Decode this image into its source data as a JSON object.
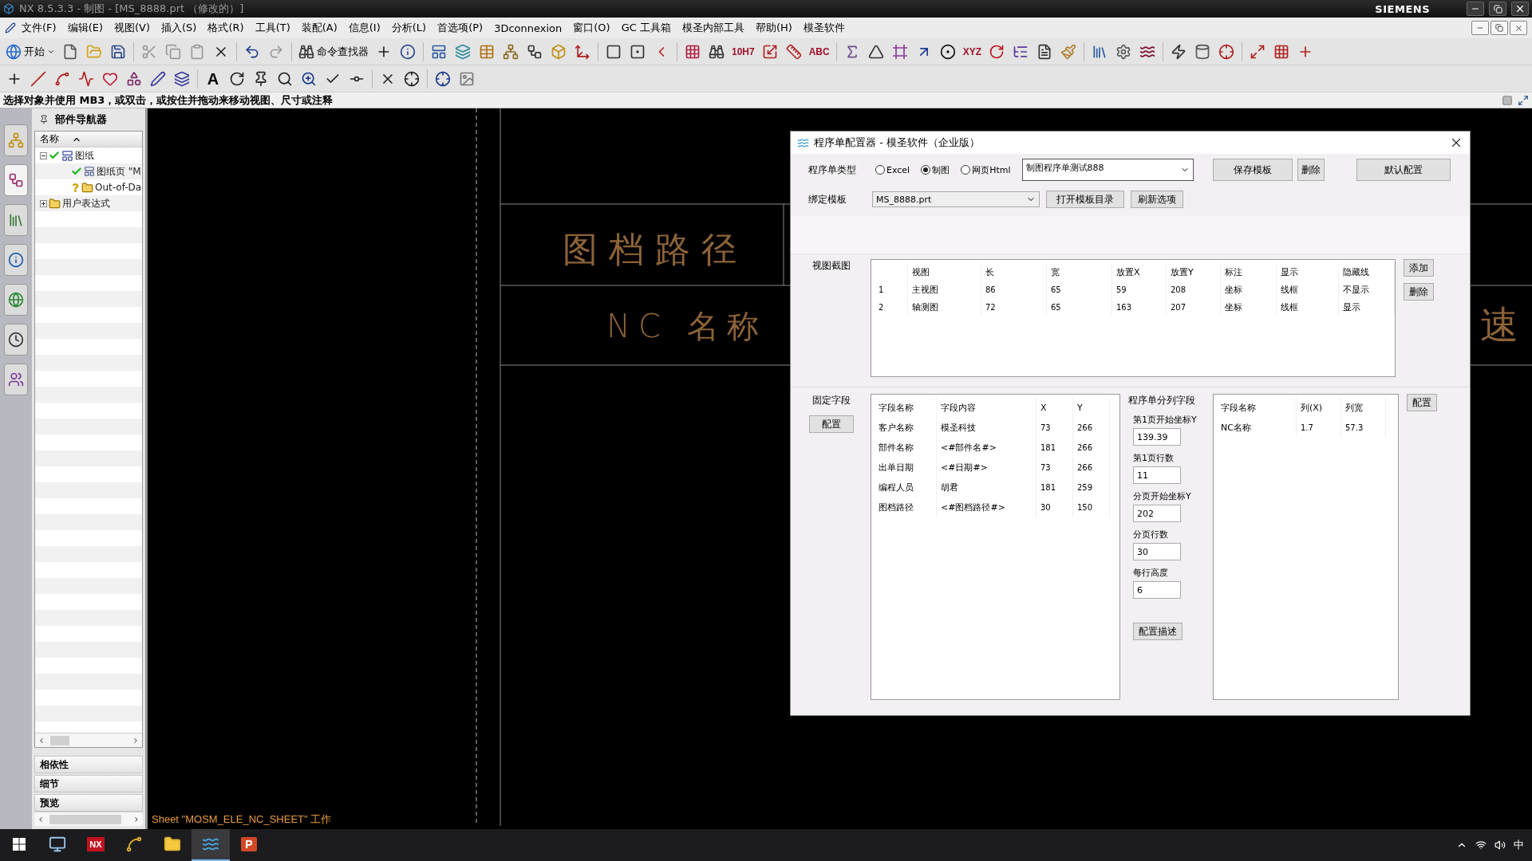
{
  "title_bar": {
    "title": "NX 8.5.3.3 - 制图 - [MS_8888.prt （修改的）]",
    "brand": "SIEMENS"
  },
  "menu": [
    "文件(F)",
    "编辑(E)",
    "视图(V)",
    "插入(S)",
    "格式(R)",
    "工具(T)",
    "装配(A)",
    "信息(I)",
    "分析(L)",
    "首选项(P)",
    "3Dconnexion",
    "窗口(O)",
    "GC 工具箱",
    "模圣内部工具",
    "帮助(H)",
    "模圣软件"
  ],
  "toolbar": {
    "start": "开始",
    "command_finder": "命令查找器",
    "row1_labels": [
      "10H7",
      "ABC",
      "XYZ"
    ],
    "row2_labels": [
      "A"
    ]
  },
  "prompt": "选择对象并使用 MB3，或双击，或按住并拖动来移动视图、尺寸或注释",
  "side_tabs": [
    {
      "selected": false
    },
    {
      "selected": true
    },
    {
      "selected": false
    },
    {
      "selected": false
    },
    {
      "selected": false
    },
    {
      "selected": false
    },
    {
      "selected": false
    }
  ],
  "navigator": {
    "title": "部件导航器",
    "column": "名称",
    "tree": [
      {
        "label": "图纸",
        "up_to_date": true,
        "expanded": true,
        "children": [
          {
            "label": "图纸页 \"M",
            "up_to_date": true,
            "kind": "sheet"
          },
          {
            "label": "Out-of-Da",
            "up_to_date": false,
            "kind": "folder"
          }
        ]
      },
      {
        "label": "用户表达式",
        "expanded": false
      }
    ],
    "panels": [
      "相依性",
      "细节",
      "预览"
    ]
  },
  "canvas": {
    "texts": [
      "图档路径",
      "NC 名称",
      "速"
    ],
    "sheet_status": "Sheet \"MOSM_ELE_NC_SHEET\" 工作"
  },
  "dialog": {
    "title": "程序单配置器 - 模圣软件（企业版）",
    "type_label": "程序单类型",
    "type_options": [
      {
        "label": "Excel",
        "selected": false
      },
      {
        "label": "制图",
        "selected": true
      },
      {
        "label": "网页Html",
        "selected": false
      }
    ],
    "template_name": "制图程序单测试888",
    "top_buttons": [
      "保存模板",
      "删除",
      "默认配置"
    ],
    "bind_label": "绑定模板",
    "bind_value": "MS_8888.prt",
    "bind_buttons": [
      "打开模板目录",
      "刷新选项"
    ],
    "views": {
      "label": "视图截图",
      "columns": [
        "",
        "视图",
        "长",
        "宽",
        "放置X",
        "放置Y",
        "标注",
        "显示",
        "隐藏线"
      ],
      "rows": [
        [
          "1",
          "主视图",
          "86",
          "65",
          "59",
          "208",
          "坐标",
          "线框",
          "不显示"
        ],
        [
          "2",
          "轴测图",
          "72",
          "65",
          "163",
          "207",
          "坐标",
          "线框",
          "显示"
        ]
      ],
      "buttons": [
        "添加",
        "删除"
      ]
    },
    "fixed": {
      "label": "固定字段",
      "button": "配置",
      "columns": [
        "字段名称",
        "字段内容",
        "X",
        "Y"
      ],
      "rows": [
        [
          "客户名称",
          "模圣科技",
          "73",
          "266"
        ],
        [
          "部件名称",
          "<#部件名#>",
          "181",
          "266"
        ],
        [
          "出单日期",
          "<#日期#>",
          "73",
          "266"
        ],
        [
          "编程人员",
          "胡君",
          "181",
          "259"
        ],
        [
          "图档路径",
          "<#图档路径#>",
          "30",
          "150"
        ]
      ]
    },
    "split": {
      "label": "程序单分列字段",
      "fields": [
        {
          "label": "第1页开始坐标Y",
          "value": "139.39"
        },
        {
          "label": "第1页行数",
          "value": "11"
        },
        {
          "label": "分页开始坐标Y",
          "value": "202"
        },
        {
          "label": "分页行数",
          "value": "30"
        },
        {
          "label": "每行高度",
          "value": "6"
        }
      ],
      "button": "配置描述"
    },
    "columns_table": {
      "columns": [
        "字段名称",
        "列(X)",
        "列宽"
      ],
      "rows": [
        [
          "NC名称",
          "1.7",
          "57.3"
        ]
      ],
      "button": "配置"
    }
  },
  "taskbar": {
    "items": [
      {
        "kind": "computer",
        "selected": false
      },
      {
        "kind": "nx",
        "label": "NX",
        "selected": false
      },
      {
        "kind": "app",
        "selected": false
      },
      {
        "kind": "folder",
        "selected": false
      },
      {
        "kind": "ms",
        "selected": true
      },
      {
        "kind": "slides",
        "label": "P",
        "selected": false
      }
    ],
    "ime": "中"
  }
}
